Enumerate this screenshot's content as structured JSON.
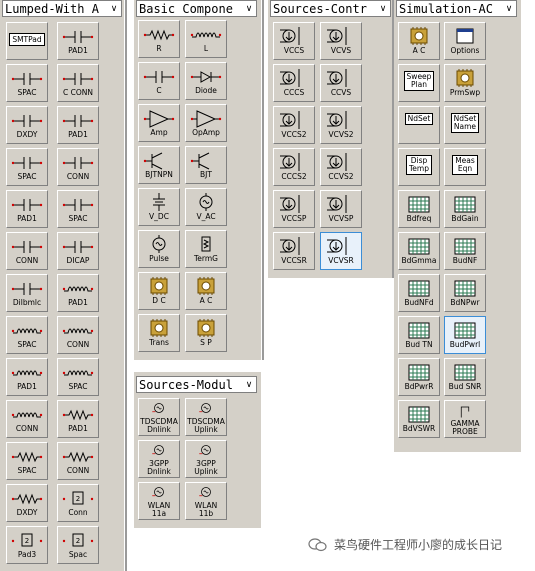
{
  "palettes": {
    "lumped": {
      "title": "Lumped-With A",
      "items": [
        "SMTPad",
        "PAD1",
        "SPAC",
        "C CONN",
        "DXDY",
        "PAD1",
        "SPAC",
        "CONN",
        "PAD1",
        "SPAC",
        "CONN",
        "DICAP",
        "Dilbmlc",
        "PAD1",
        "SPAC",
        "CONN",
        "PAD1",
        "SPAC",
        "CONN",
        "PAD1",
        "SPAC",
        "CONN",
        "DXDY",
        "Conn",
        "Pad3",
        "Spac"
      ]
    },
    "basic": {
      "title": "Basic Compone",
      "items": [
        "R",
        "L",
        "C",
        "Diode",
        "Amp",
        "OpAmp",
        "BJTNPN",
        "BJT",
        "V_DC",
        "V_AC",
        "Pulse",
        "TermG",
        "D C",
        "A C",
        "Trans",
        "S P"
      ]
    },
    "sources_ctrl": {
      "title": "Sources-Contr",
      "items": [
        "VCCS",
        "VCVS",
        "CCCS",
        "CCVS",
        "VCCS2",
        "VCVS2",
        "CCCS2",
        "CCVS2",
        "VCCSP",
        "VCVSP",
        "VCCSR",
        "VCVSR"
      ]
    },
    "sources_mod": {
      "title": "Sources-Modul",
      "items": [
        "TDSCDMA\nDnlink",
        "TDSCDMA\nUplink",
        "3GPP\nDnlink",
        "3GPP\nUplink",
        "WLAN\n11a",
        "WLAN\n11b"
      ]
    },
    "simulation": {
      "title": "Simulation-AC",
      "items": [
        "A C",
        "Options",
        "Sweep\nPlan",
        "PrmSwp",
        "NdSet",
        "NdSet\nName",
        "Disp\nTemp",
        "Meas\nEqn",
        "Bdfreq",
        "BdGain",
        "BdGmma",
        "BudNF",
        "BudNFd",
        "BdNPwr",
        "Bud TN",
        "BudPwrl",
        "BdPwrR",
        "Bud SNR",
        "BdVSWR",
        "GAMMA\nPROBE"
      ]
    }
  },
  "watermark": "菜鸟硬件工程师小廖的成长日记"
}
